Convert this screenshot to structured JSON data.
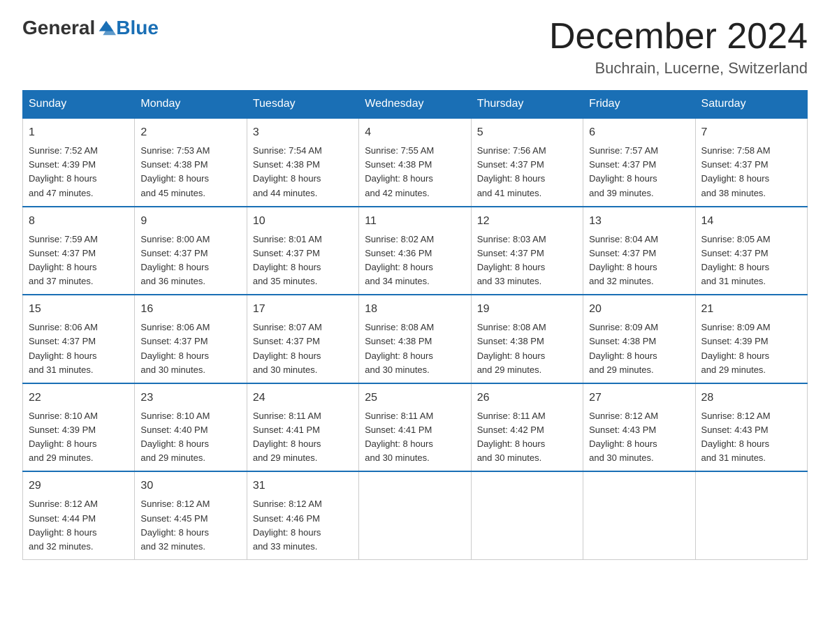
{
  "logo": {
    "text_general": "General",
    "text_blue": "Blue"
  },
  "header": {
    "month_title": "December 2024",
    "location": "Buchrain, Lucerne, Switzerland"
  },
  "days_of_week": [
    "Sunday",
    "Monday",
    "Tuesday",
    "Wednesday",
    "Thursday",
    "Friday",
    "Saturday"
  ],
  "weeks": [
    [
      {
        "day": "1",
        "sunrise": "7:52 AM",
        "sunset": "4:39 PM",
        "daylight": "8 hours and 47 minutes."
      },
      {
        "day": "2",
        "sunrise": "7:53 AM",
        "sunset": "4:38 PM",
        "daylight": "8 hours and 45 minutes."
      },
      {
        "day": "3",
        "sunrise": "7:54 AM",
        "sunset": "4:38 PM",
        "daylight": "8 hours and 44 minutes."
      },
      {
        "day": "4",
        "sunrise": "7:55 AM",
        "sunset": "4:38 PM",
        "daylight": "8 hours and 42 minutes."
      },
      {
        "day": "5",
        "sunrise": "7:56 AM",
        "sunset": "4:37 PM",
        "daylight": "8 hours and 41 minutes."
      },
      {
        "day": "6",
        "sunrise": "7:57 AM",
        "sunset": "4:37 PM",
        "daylight": "8 hours and 39 minutes."
      },
      {
        "day": "7",
        "sunrise": "7:58 AM",
        "sunset": "4:37 PM",
        "daylight": "8 hours and 38 minutes."
      }
    ],
    [
      {
        "day": "8",
        "sunrise": "7:59 AM",
        "sunset": "4:37 PM",
        "daylight": "8 hours and 37 minutes."
      },
      {
        "day": "9",
        "sunrise": "8:00 AM",
        "sunset": "4:37 PM",
        "daylight": "8 hours and 36 minutes."
      },
      {
        "day": "10",
        "sunrise": "8:01 AM",
        "sunset": "4:37 PM",
        "daylight": "8 hours and 35 minutes."
      },
      {
        "day": "11",
        "sunrise": "8:02 AM",
        "sunset": "4:36 PM",
        "daylight": "8 hours and 34 minutes."
      },
      {
        "day": "12",
        "sunrise": "8:03 AM",
        "sunset": "4:37 PM",
        "daylight": "8 hours and 33 minutes."
      },
      {
        "day": "13",
        "sunrise": "8:04 AM",
        "sunset": "4:37 PM",
        "daylight": "8 hours and 32 minutes."
      },
      {
        "day": "14",
        "sunrise": "8:05 AM",
        "sunset": "4:37 PM",
        "daylight": "8 hours and 31 minutes."
      }
    ],
    [
      {
        "day": "15",
        "sunrise": "8:06 AM",
        "sunset": "4:37 PM",
        "daylight": "8 hours and 31 minutes."
      },
      {
        "day": "16",
        "sunrise": "8:06 AM",
        "sunset": "4:37 PM",
        "daylight": "8 hours and 30 minutes."
      },
      {
        "day": "17",
        "sunrise": "8:07 AM",
        "sunset": "4:37 PM",
        "daylight": "8 hours and 30 minutes."
      },
      {
        "day": "18",
        "sunrise": "8:08 AM",
        "sunset": "4:38 PM",
        "daylight": "8 hours and 30 minutes."
      },
      {
        "day": "19",
        "sunrise": "8:08 AM",
        "sunset": "4:38 PM",
        "daylight": "8 hours and 29 minutes."
      },
      {
        "day": "20",
        "sunrise": "8:09 AM",
        "sunset": "4:38 PM",
        "daylight": "8 hours and 29 minutes."
      },
      {
        "day": "21",
        "sunrise": "8:09 AM",
        "sunset": "4:39 PM",
        "daylight": "8 hours and 29 minutes."
      }
    ],
    [
      {
        "day": "22",
        "sunrise": "8:10 AM",
        "sunset": "4:39 PM",
        "daylight": "8 hours and 29 minutes."
      },
      {
        "day": "23",
        "sunrise": "8:10 AM",
        "sunset": "4:40 PM",
        "daylight": "8 hours and 29 minutes."
      },
      {
        "day": "24",
        "sunrise": "8:11 AM",
        "sunset": "4:41 PM",
        "daylight": "8 hours and 29 minutes."
      },
      {
        "day": "25",
        "sunrise": "8:11 AM",
        "sunset": "4:41 PM",
        "daylight": "8 hours and 30 minutes."
      },
      {
        "day": "26",
        "sunrise": "8:11 AM",
        "sunset": "4:42 PM",
        "daylight": "8 hours and 30 minutes."
      },
      {
        "day": "27",
        "sunrise": "8:12 AM",
        "sunset": "4:43 PM",
        "daylight": "8 hours and 30 minutes."
      },
      {
        "day": "28",
        "sunrise": "8:12 AM",
        "sunset": "4:43 PM",
        "daylight": "8 hours and 31 minutes."
      }
    ],
    [
      {
        "day": "29",
        "sunrise": "8:12 AM",
        "sunset": "4:44 PM",
        "daylight": "8 hours and 32 minutes."
      },
      {
        "day": "30",
        "sunrise": "8:12 AM",
        "sunset": "4:45 PM",
        "daylight": "8 hours and 32 minutes."
      },
      {
        "day": "31",
        "sunrise": "8:12 AM",
        "sunset": "4:46 PM",
        "daylight": "8 hours and 33 minutes."
      },
      null,
      null,
      null,
      null
    ]
  ]
}
